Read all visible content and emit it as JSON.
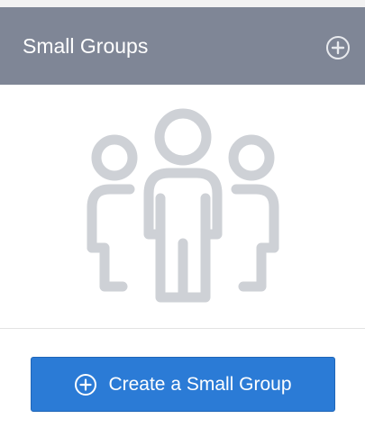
{
  "panel": {
    "title": "Small Groups",
    "header_add_icon": "plus-circle-icon",
    "empty_state_icon": "people-group-icon",
    "create_button": {
      "label": "Create a Small Group",
      "icon": "plus-circle-icon"
    }
  },
  "colors": {
    "header_background": "#7f8696",
    "illustration": "#ced1d6",
    "button_background": "#2b7bd6",
    "text_on_dark": "#ffffff"
  }
}
